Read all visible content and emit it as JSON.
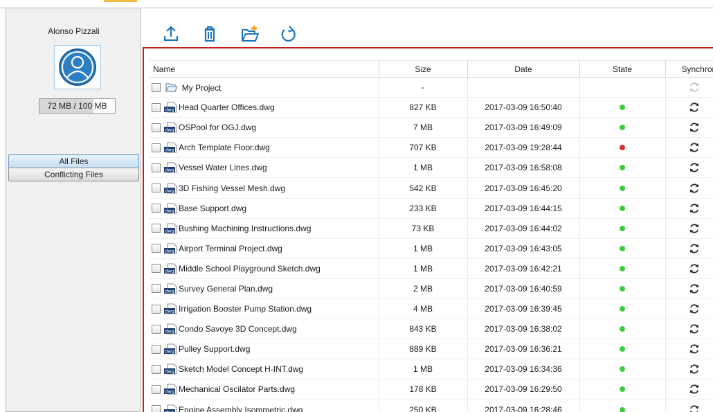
{
  "user": {
    "name": "Alonso Pizzali",
    "quota_text": "72 MB / 100 MB",
    "quota_used_fraction": 0.72
  },
  "nav": {
    "all_files": "All Files",
    "conflicting_files": "Conflicting Files"
  },
  "toolbar": {
    "upload_icon": "upload-icon",
    "delete_icon": "trash-icon",
    "new_folder_icon": "folder-add-icon",
    "refresh_icon": "refresh-icon"
  },
  "table": {
    "headers": {
      "name": "Name",
      "size": "Size",
      "date": "Date",
      "state": "State",
      "sync": "Synchroniz"
    },
    "folder": {
      "name": "My Project",
      "size": "-",
      "date": "",
      "state": "",
      "icon": "folder-icon"
    },
    "files": [
      {
        "name": "Head Quarter Offices.dwg",
        "size": "827 KB",
        "date": "2017-03-09 16:50:40",
        "state": "ok"
      },
      {
        "name": "OSPool for OGJ.dwg",
        "size": "7 MB",
        "date": "2017-03-09 16:49:09",
        "state": "ok"
      },
      {
        "name": "Arch Template Floor.dwg",
        "size": "707 KB",
        "date": "2017-03-09 19:28:44",
        "state": "conflict"
      },
      {
        "name": "Vessel Water Lines.dwg",
        "size": "1 MB",
        "date": "2017-03-09 16:58:08",
        "state": "ok"
      },
      {
        "name": "3D Fishing Vessel Mesh.dwg",
        "size": "542 KB",
        "date": "2017-03-09 16:45:20",
        "state": "ok"
      },
      {
        "name": "Base Support.dwg",
        "size": "233 KB",
        "date": "2017-03-09 16:44:15",
        "state": "ok"
      },
      {
        "name": "Bushing Machining Instructions.dwg",
        "size": "73 KB",
        "date": "2017-03-09 16:44:02",
        "state": "ok"
      },
      {
        "name": "Airport Terminal Project.dwg",
        "size": "1 MB",
        "date": "2017-03-09 16:43:05",
        "state": "ok"
      },
      {
        "name": "Middle School Playground Sketch.dwg",
        "size": "1 MB",
        "date": "2017-03-09 16:42:21",
        "state": "ok"
      },
      {
        "name": "Survey General Plan.dwg",
        "size": "2 MB",
        "date": "2017-03-09 16:40:59",
        "state": "ok"
      },
      {
        "name": "Irrigation Booster Pump Station.dwg",
        "size": "4 MB",
        "date": "2017-03-09 16:39:45",
        "state": "ok"
      },
      {
        "name": "Condo Savoye 3D Concept.dwg",
        "size": "843 KB",
        "date": "2017-03-09 16:38:02",
        "state": "ok"
      },
      {
        "name": "Pulley Support.dwg",
        "size": "889 KB",
        "date": "2017-03-09 16:36:21",
        "state": "ok"
      },
      {
        "name": "Sketch Model Concept H-INT.dwg",
        "size": "1 MB",
        "date": "2017-03-09 16:34:36",
        "state": "ok"
      },
      {
        "name": "Mechanical Oscilator Parts.dwg",
        "size": "178 KB",
        "date": "2017-03-09 16:29:50",
        "state": "ok"
      },
      {
        "name": "Engine Assembly Isommetric.dwg",
        "size": "250 KB",
        "date": "2017-03-09 16:28:46",
        "state": "ok"
      }
    ],
    "file_icon_label": "dwg",
    "state_colors": {
      "ok": "#3dcc3d",
      "conflict": "#d83030"
    }
  },
  "colors": {
    "accent": "#1c74b8",
    "panel_border": "#c81d1d"
  }
}
